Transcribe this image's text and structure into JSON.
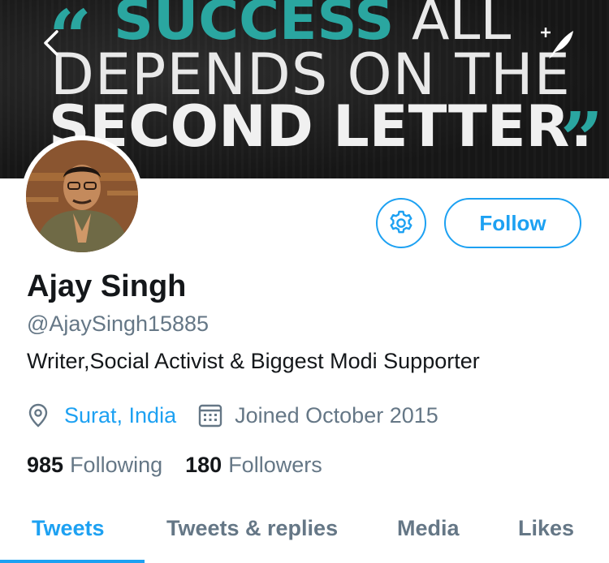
{
  "banner": {
    "quote_open": "“",
    "line1_teal": "SUCCESS",
    "line1_white": " ALL",
    "line2": "DEPENDS ON THE",
    "line3": "SECOND LETTER.",
    "quote_close": "”",
    "teal_color": "#2aa6a0"
  },
  "nav": {
    "back_icon": "chevron-left-icon",
    "compose_icon": "compose-feather-icon"
  },
  "profile": {
    "name": "Ajay Singh",
    "handle": "@AjaySingh15885",
    "bio": "Writer,Social Activist & Biggest Modi Supporter",
    "location": "Surat, India",
    "joined": "Joined October 2015",
    "following_count": "985",
    "following_label": "Following",
    "followers_count": "180",
    "followers_label": "Followers"
  },
  "actions": {
    "follow_label": "Follow",
    "settings_icon": "gear-icon"
  },
  "tabs": [
    {
      "label": "Tweets",
      "active": true
    },
    {
      "label": "Tweets & replies",
      "active": false
    },
    {
      "label": "Media",
      "active": false
    },
    {
      "label": "Likes",
      "active": false
    }
  ],
  "colors": {
    "accent": "#1da1f2",
    "text_primary": "#14171a",
    "text_secondary": "#657786"
  }
}
